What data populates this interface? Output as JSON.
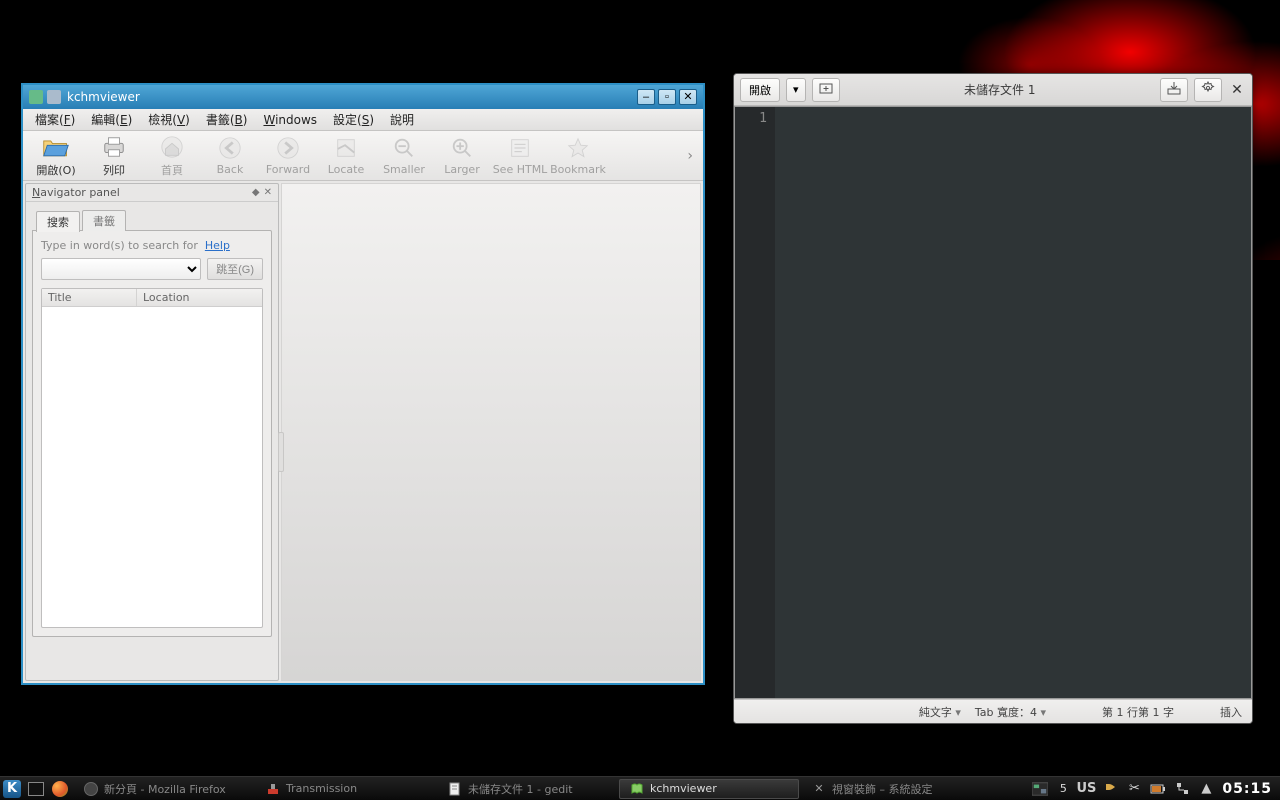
{
  "kchm": {
    "title": "kchmviewer",
    "menu": [
      {
        "t": "檔案(",
        "u": "F",
        "s": ")"
      },
      {
        "t": "編輯(",
        "u": "E",
        "s": ")"
      },
      {
        "t": "檢視(",
        "u": "V",
        "s": ")"
      },
      {
        "t": "書籤(",
        "u": "B",
        "s": ")"
      },
      {
        "t": "",
        "u": "W",
        "s": "indows"
      },
      {
        "t": "設定(",
        "u": "S",
        "s": ")"
      },
      {
        "t": "說明",
        "u": "",
        "s": ""
      }
    ],
    "tools": {
      "open": "開啟(O)",
      "print": "列印",
      "home": "首頁",
      "back": "Back",
      "forward": "Forward",
      "locate": "Locate",
      "smaller": "Smaller",
      "larger": "Larger",
      "seehtml": "See HTML",
      "bookmark": "Bookmark"
    },
    "nav": {
      "title_pre": "",
      "title_u": "N",
      "title_post": "avigator panel",
      "tab_search": "搜索",
      "tab_bookmark": "書籤",
      "hint": "Type in word(s) to search for",
      "help": "Help",
      "go": "跳至(G)",
      "col_title": "Title",
      "col_location": "Location"
    }
  },
  "gedit": {
    "open": "開啟",
    "title": "未儲存文件 1",
    "line_no": "1",
    "status": {
      "lang": "純文字",
      "tab": "Tab 寬度：4",
      "pos": "第 1 行第 1 字",
      "mode": "插入"
    }
  },
  "taskbar": {
    "firefox": "新分頁 - Mozilla Firefox",
    "transmission": "Transmission",
    "gedit": "未儲存文件 1 - gedit",
    "kchm": "kchmviewer",
    "deco": "視窗裝飾 – 系統設定",
    "desktop": "5",
    "kbd": "US",
    "clock": "05:15"
  }
}
